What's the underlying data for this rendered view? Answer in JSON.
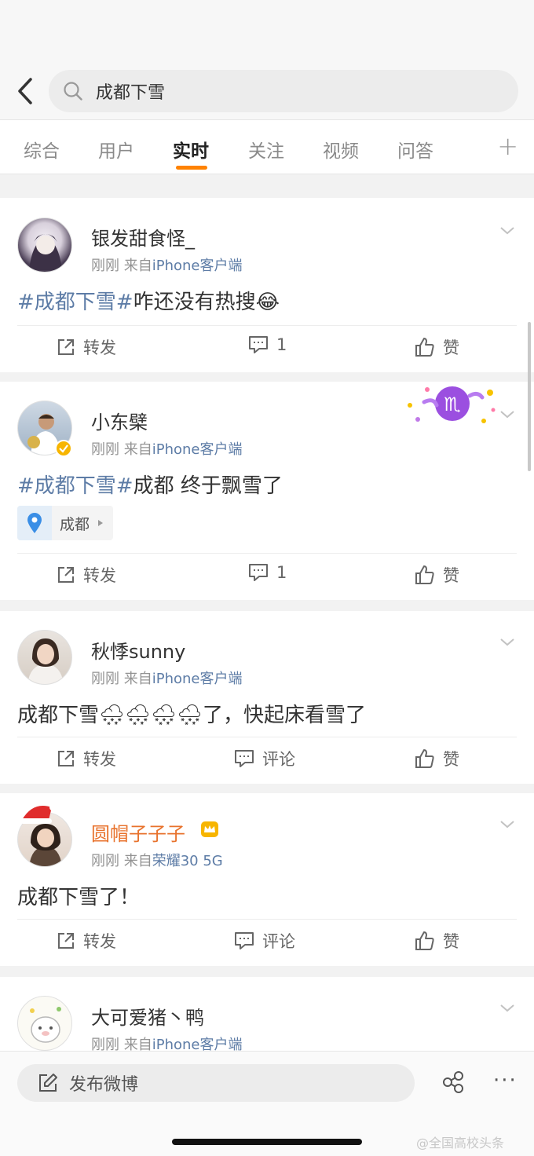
{
  "search": {
    "query": "成都下雪"
  },
  "tabs": [
    {
      "label": "综合"
    },
    {
      "label": "用户"
    },
    {
      "label": "实时"
    },
    {
      "label": "关注"
    },
    {
      "label": "视频"
    },
    {
      "label": "问答"
    }
  ],
  "tab_add": "+",
  "posts": [
    {
      "username": "银发甜食怪_",
      "time": "刚刚",
      "from": "来自",
      "source": "iPhone客户端",
      "hashtag": "#成都下雪#",
      "text": "咋还没有热搜😂",
      "repost": "转发",
      "comments": "1",
      "like": "赞"
    },
    {
      "username": "小东檗",
      "time": "刚刚",
      "from": "来自",
      "source": "iPhone客户端",
      "hashtag": "#成都下雪#",
      "text": "成都 终于飘雪了",
      "location": "成都",
      "repost": "转发",
      "comments": "1",
      "like": "赞"
    },
    {
      "username": "秋悸sunny",
      "time": "刚刚",
      "from": "来自",
      "source": "iPhone客户端",
      "text": "成都下雪🌨🌨🌨🌨了，快起床看雪了",
      "repost": "转发",
      "comment": "评论",
      "like": "赞"
    },
    {
      "username": "圆帽子子子",
      "time": "刚刚",
      "from": "来自",
      "source": "荣耀30 5G",
      "text": "成都下雪了！",
      "repost": "转发",
      "comment": "评论",
      "like": "赞"
    },
    {
      "username": "大可爱猪丶鸭",
      "time": "刚刚",
      "from": "来自",
      "source": "iPhone客户端"
    }
  ],
  "compose": {
    "label": "发布微博"
  },
  "more": "···",
  "watermark": "@全国高校头条",
  "colors": {
    "accent": "#ff8200",
    "link": "#5d7ca6",
    "vip_name": "#e8722c"
  }
}
